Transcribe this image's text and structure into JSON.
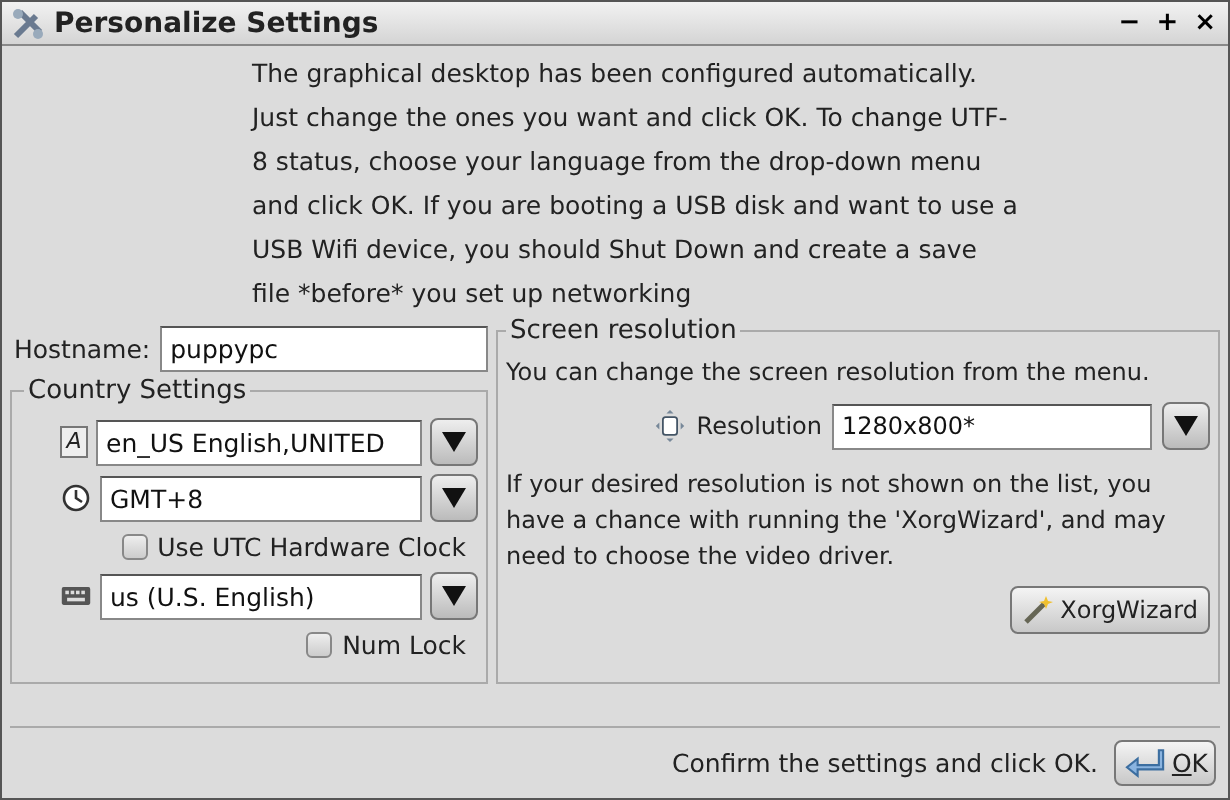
{
  "window": {
    "title": "Personalize Settings",
    "controls": [
      "−",
      "+",
      "×"
    ]
  },
  "intro": "The graphical desktop has been configured automatically. Just change the ones you want and click OK. To change UTF-8 status, choose your language from the drop-down menu and click OK. If you are booting a USB disk and want to use a USB Wifi device, you should Shut Down and create a save file *before* you set up networking",
  "hostname": {
    "label": "Hostname:",
    "value": "puppypc"
  },
  "country": {
    "title": "Country Settings",
    "rows": [
      {
        "kind": "combo",
        "glyph": "A",
        "value": "en_US English,UNITED"
      },
      {
        "kind": "combo",
        "value": "GMT+8"
      },
      {
        "kind": "check",
        "label": "Use UTC Hardware Clock",
        "checked": false
      },
      {
        "kind": "combo",
        "value": "us (U.S. English)"
      },
      {
        "kind": "check",
        "label": "Num Lock",
        "checked": false
      }
    ]
  },
  "screen": {
    "title": "Screen resolution",
    "hint": "You can change the screen resolution from the menu.",
    "resolution_label": "Resolution",
    "resolution_value": "1280x800*",
    "note": "If your desired resolution is not shown on the list, you have a chance with running the 'XorgWizard', and may need to choose the video driver.",
    "wizard_button": "XorgWizard"
  },
  "footer": {
    "text": "Confirm the settings and click OK.",
    "ok_button": "OK"
  }
}
